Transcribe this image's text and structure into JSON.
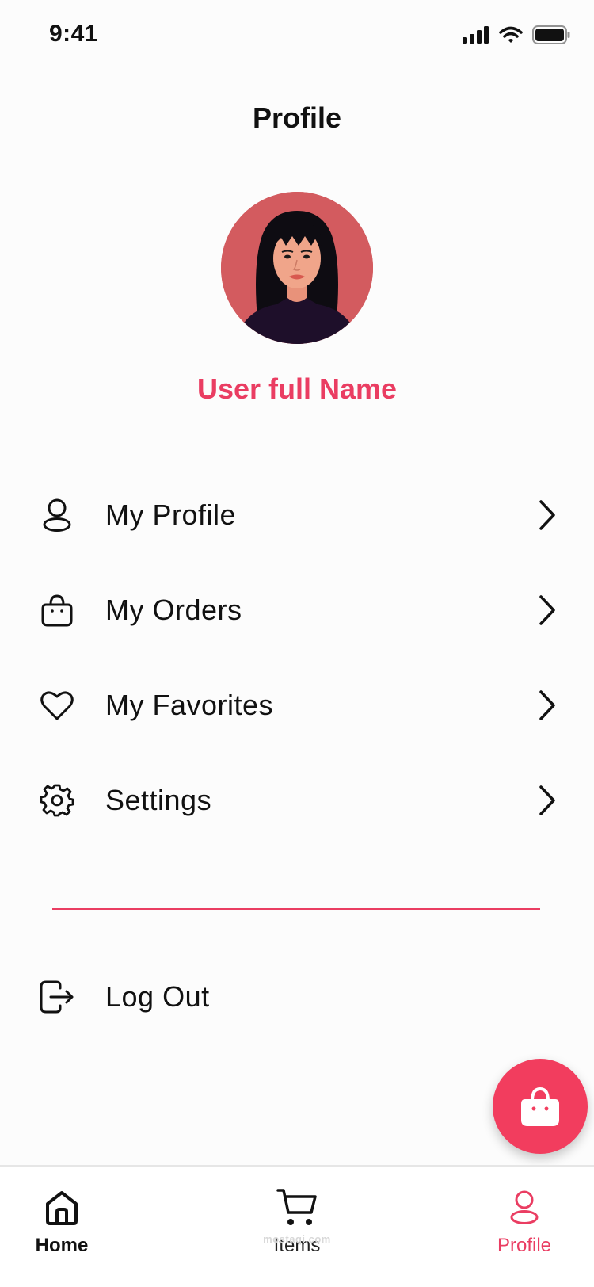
{
  "status_bar": {
    "time": "9:41"
  },
  "header": {
    "title": "Profile"
  },
  "user": {
    "full_name": "User full Name"
  },
  "menu": {
    "items": [
      {
        "label": "My Profile",
        "icon": "user-icon"
      },
      {
        "label": "My Orders",
        "icon": "shopping-bag-icon"
      },
      {
        "label": "My Favorites",
        "icon": "heart-icon"
      },
      {
        "label": "Settings",
        "icon": "gear-icon"
      }
    ]
  },
  "logout": {
    "label": "Log Out",
    "icon": "logout-icon"
  },
  "fab": {
    "icon": "shopping-bag-icon"
  },
  "bottom_nav": {
    "items": [
      {
        "label": "Home",
        "icon": "home-icon"
      },
      {
        "label": "Items",
        "icon": "cart-icon"
      },
      {
        "label": "Profile",
        "icon": "user-icon",
        "active": true
      }
    ]
  },
  "watermark": "mostaqi.com",
  "colors": {
    "accent": "#ea3d62",
    "fab": "#f23d5e",
    "avatar_bg": "#d35b5f"
  }
}
